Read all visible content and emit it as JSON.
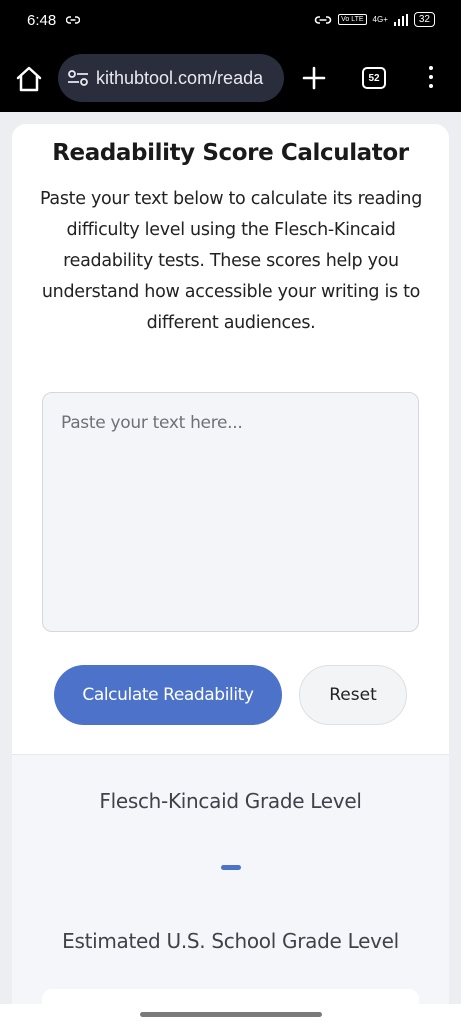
{
  "status_bar": {
    "time": "6:48",
    "network": "4G+",
    "volte": "Vo LTE",
    "battery": "32"
  },
  "browser": {
    "url": "kithubtool.com/reada",
    "tab_count": "52",
    "icons": [
      "home-icon",
      "site-settings-icon",
      "new-tab-icon",
      "tab-switcher-icon",
      "more-menu-icon"
    ]
  },
  "page": {
    "title": "Readability Score Calculator",
    "description": "Paste your text below to calculate its reading difficulty level using the Flesch-Kincaid readability tests. These scores help you understand how accessible your writing is to different audiences.",
    "textarea_placeholder": "Paste your text here...",
    "calculate_label": "Calculate Readability",
    "reset_label": "Reset",
    "accent_color": "#4c72c9"
  },
  "results": {
    "fk_label": "Flesch-Kincaid Grade Level",
    "fk_value": "–",
    "grade_label": "Estimated U.S. School Grade Level"
  }
}
